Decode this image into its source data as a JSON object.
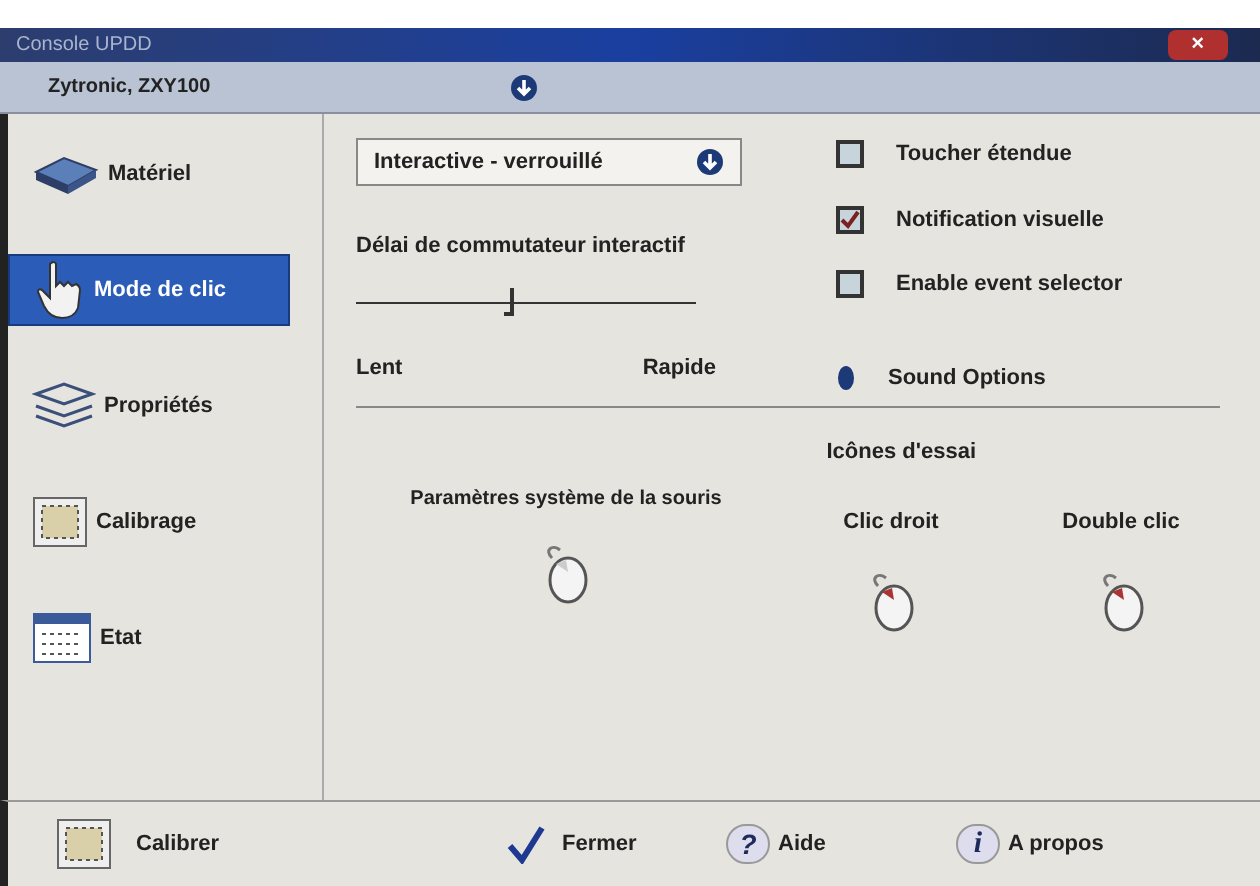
{
  "window": {
    "title": "Console UPDD",
    "close": "×"
  },
  "device": {
    "name": "Zytronic, ZXY100"
  },
  "sidebar": {
    "items": [
      {
        "label": "Matériel",
        "selected": false
      },
      {
        "label": "Mode de clic",
        "selected": true
      },
      {
        "label": "Propriétés",
        "selected": false
      },
      {
        "label": "Calibrage",
        "selected": false
      },
      {
        "label": "Etat",
        "selected": false
      }
    ]
  },
  "mode_select": {
    "value": "Interactive - verrouillé"
  },
  "delay": {
    "label": "Délai de commutateur interactif",
    "level": 0.45,
    "min_label": "Lent",
    "max_label": "Rapide"
  },
  "checkboxes": [
    {
      "label": "Toucher étendue",
      "checked": false
    },
    {
      "label": "Notification visuelle",
      "checked": true
    },
    {
      "label": "Enable event selector",
      "checked": false
    }
  ],
  "sound_options": "Sound Options",
  "test_icons": {
    "title": "Icônes d'essai",
    "system_settings": "Paramètres système de la souris",
    "items": [
      {
        "label": "Clic droit",
        "active": true
      },
      {
        "label": "Double clic",
        "active": true
      }
    ],
    "system_active": false
  },
  "footer": {
    "calibrate": "Calibrer",
    "close": "Fermer",
    "help": "Aide",
    "about": "A propos",
    "help_glyph": "?",
    "about_glyph": "i"
  }
}
